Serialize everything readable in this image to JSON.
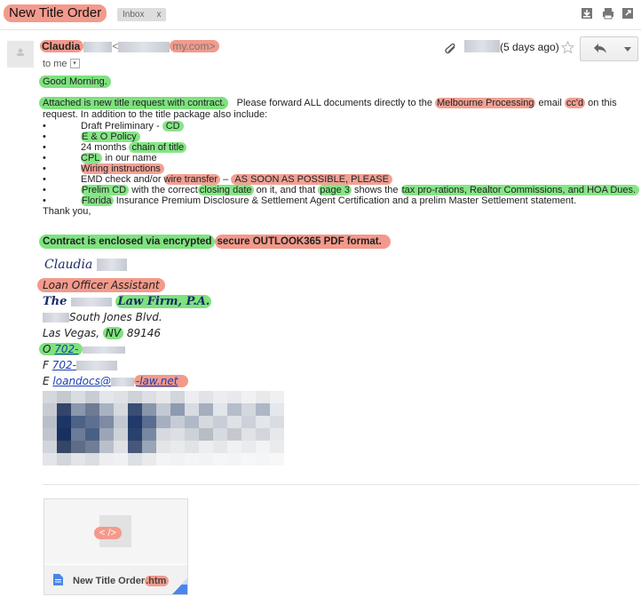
{
  "subject": "New Title Order",
  "inbox_label": "Inbox",
  "inbox_label_close": "x",
  "sender": {
    "name": "Claudia",
    "email_prefix": "<",
    "email_suffix": "my.com>"
  },
  "to_me": "to me",
  "time": "(5 days ago)",
  "body": {
    "greeting": "Good Morning.",
    "p1_hl1": "Attached is new title request with contract.",
    "p1_t1": "Please forward ALL documents directly to the",
    "p1_hl2": "Melbourne Processing",
    "p1_t2": "email",
    "p1_hl3": "cc'd",
    "p1_t3": "on this",
    "p2": "request.  In addition to the title package also include:",
    "bullet": "•",
    "i1_t": "Draft Preliminary -",
    "i1_h": "CD",
    "i2": "E & O Policy",
    "i3_t": "24 months",
    "i3_h": "chain of title",
    "i4_h": "CPL",
    "i4_t": "in our name",
    "i5": "Wiring instructions",
    "i6_t": "EMD check and/or",
    "i6_h1": "wire transfer",
    "i6_t2": "–",
    "i6_h2": "AS SOON AS POSSIBLE, PLEASE",
    "i7_h1": "Prelim CD",
    "i7_t1": "with the correct",
    "i7_h2": "closing date",
    "i7_t2": "on it, and that",
    "i7_h3": "page 3",
    "i7_t3": "shows the",
    "i7_h4": "tax pro-rations, Realtor Commissions, and HOA Dues.",
    "i8_h": "Florida",
    "i8_t": "Insurance Premium Disclosure & Settlement Agent Certification and a prelim Master Settlement statement.",
    "thanks": "Thank you,",
    "enc1": "Contract is enclosed via encrypted",
    "enc2": "secure OUTLOOK365 PDF format."
  },
  "signature": {
    "name": "Claudia",
    "title": "Loan Officer Assistant",
    "firm_the": "The",
    "firm_rest": "Law Firm, P.A.",
    "street": "South Jones Blvd.",
    "city": "Las Vegas,",
    "state": "NV",
    "zip": "89146",
    "o_label": "O",
    "o_num": "702-",
    "f_label": "F",
    "f_num": "702-",
    "e_label": "E",
    "e_user": "loandocs@",
    "e_domain": "-law.net"
  },
  "attachment": {
    "preview_glyph": "< />",
    "name": "New Title Order",
    "ext": ".htm"
  },
  "icons": {
    "download": "download-icon",
    "print": "print-icon",
    "new_window": "new-window-icon",
    "paperclip": "paperclip-icon",
    "star": "star-icon",
    "reply": "reply-icon",
    "more": "chevron-down-icon"
  },
  "colors": {
    "highlight_red": "#f39a8c",
    "highlight_green": "#7ee27e",
    "firm_blue": "#1b2a6b",
    "link_blue": "#1a3fb0"
  }
}
